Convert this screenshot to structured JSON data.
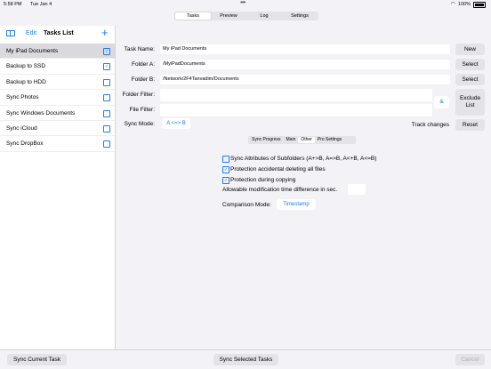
{
  "status": {
    "time": "5:58 PM",
    "date": "Tue Jan 4",
    "battery": "100%"
  },
  "tabs": [
    {
      "label": "Tasks",
      "active": true
    },
    {
      "label": "Preview",
      "active": false
    },
    {
      "label": "Log",
      "active": false
    },
    {
      "label": "Settings",
      "active": false
    }
  ],
  "sidebar": {
    "edit": "Edit",
    "title": "Tasks List",
    "add": "+",
    "items": [
      {
        "label": "My iPad Documents",
        "checked": true
      },
      {
        "label": "Backup to SSD",
        "checked": true
      },
      {
        "label": "Backup to HDD",
        "checked": false
      },
      {
        "label": "Sync Photos",
        "checked": false
      },
      {
        "label": "Sync Windows Documents",
        "checked": false
      },
      {
        "label": "Sync iCloud",
        "checked": false
      },
      {
        "label": "Sync DropBox",
        "checked": false
      }
    ]
  },
  "form": {
    "task_name_label": "Task Name:",
    "task_name": "My iPad Documents",
    "folder_a_label": "Folder A:",
    "folder_a": "/MyiPadDocuments",
    "folder_b_label": "Folder B:",
    "folder_b": "/Network/2F4Tanvadim/Documents",
    "folder_filter_label": "Folder Filter:",
    "folder_filter": "",
    "file_filter_label": "File Filter:",
    "file_filter": "",
    "sync_mode_label": "Sync Mode:",
    "sync_mode": "A <=> B",
    "track_changes": "Track changes",
    "amp": "&"
  },
  "buttons": {
    "new": "New",
    "select_a": "Select",
    "select_b": "Select",
    "exclude_line1": "Exclude",
    "exclude_line2": "List",
    "reset": "Reset"
  },
  "subtabs": [
    {
      "label": "Sync Progress",
      "active": false
    },
    {
      "label": "Main",
      "active": false
    },
    {
      "label": "Other",
      "active": true
    },
    {
      "label": "Pro Settings",
      "active": false
    }
  ],
  "options": {
    "sync_attributes": "Sync Attributes of Subfolders (A+>B, A=>B, A<+B, A<=B)",
    "sync_attributes_checked": false,
    "protection_deleting": "Protection accidental deleting all files",
    "protection_deleting_checked": true,
    "protection_copying": "Protection during copying",
    "protection_copying_checked": true,
    "time_diff": "Allowable modification time difference in sec.",
    "time_diff_value": "",
    "comparison_label": "Comparison Mode:",
    "comparison_value": "Timestamp"
  },
  "bottom": {
    "sync_current": "Sync Current Task",
    "sync_selected": "Sync Selected Tasks",
    "cancel": "Cancel"
  }
}
